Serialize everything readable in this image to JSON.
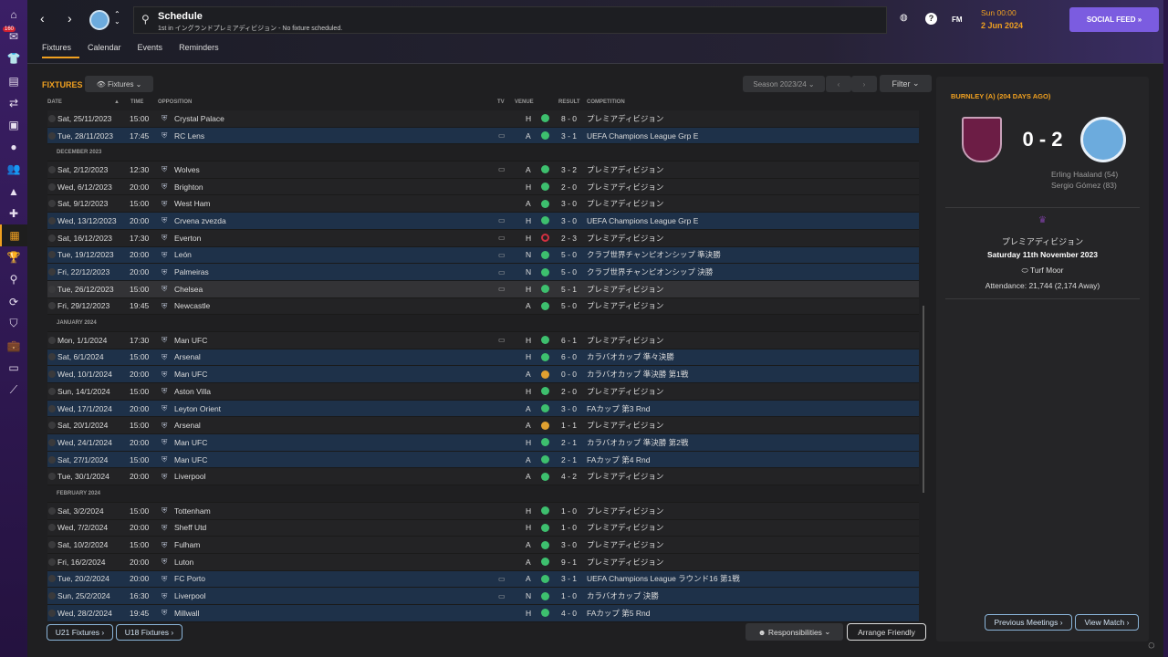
{
  "sidebar": {
    "badge": "160",
    "icons": [
      "home-icon",
      "inbox-icon",
      "squad-icon",
      "tactics-icon",
      "transfers-icon",
      "scouting-icon",
      "ball-icon",
      "staff-icon",
      "training-icon",
      "medical-icon",
      "schedule-icon",
      "trophy-icon",
      "search-icon",
      "refresh-icon",
      "club-icon",
      "finances-icon",
      "dev-icon",
      "misc-icon"
    ]
  },
  "header": {
    "title": "Schedule",
    "subtitle": "1st in イングランドプレミアディビジョン - No fixture scheduled.",
    "time": "Sun 00:00",
    "date": "2 Jun 2024",
    "fm": "FM",
    "social_feed": "SOCIAL FEED"
  },
  "tabs": [
    {
      "label": "Fixtures"
    },
    {
      "label": "Calendar"
    },
    {
      "label": "Events"
    },
    {
      "label": "Reminders"
    }
  ],
  "fixtures": {
    "title": "FIXTURES",
    "view": "Fixtures",
    "season": "Season 2023/24",
    "filter": "Filter",
    "columns": {
      "date": "DATE",
      "time": "TIME",
      "opposition": "OPPOSITION",
      "tv": "TV",
      "venue": "VENUE",
      "result": "RESULT",
      "competition": "COMPETITION"
    },
    "rows": [
      {
        "date": "Sat, 25/11/2023",
        "time": "15:00",
        "team": "Crystal Palace",
        "tv": "",
        "venue": "H",
        "res": "W",
        "score": "8 - 0",
        "comp": "プレミアディビジョン",
        "style": ""
      },
      {
        "date": "Tue, 28/11/2023",
        "time": "17:45",
        "team": "RC Lens",
        "tv": "tv",
        "venue": "A",
        "res": "W",
        "score": "3 - 1",
        "comp": "UEFA Champions League Grp E",
        "style": "hl"
      },
      {
        "month": "DECEMBER 2023"
      },
      {
        "date": "Sat, 2/12/2023",
        "time": "12:30",
        "team": "Wolves",
        "tv": "tv",
        "venue": "A",
        "res": "W",
        "score": "3 - 2",
        "comp": "プレミアディビジョン",
        "style": ""
      },
      {
        "date": "Wed, 6/12/2023",
        "time": "20:00",
        "team": "Brighton",
        "tv": "",
        "venue": "H",
        "res": "W",
        "score": "2 - 0",
        "comp": "プレミアディビジョン",
        "style": ""
      },
      {
        "date": "Sat, 9/12/2023",
        "time": "15:00",
        "team": "West Ham",
        "tv": "",
        "venue": "A",
        "res": "W",
        "score": "3 - 0",
        "comp": "プレミアディビジョン",
        "style": ""
      },
      {
        "date": "Wed, 13/12/2023",
        "time": "20:00",
        "team": "Crvena zvezda",
        "tv": "tv",
        "venue": "H",
        "res": "W",
        "score": "3 - 0",
        "comp": "UEFA Champions League Grp E",
        "style": "hl"
      },
      {
        "date": "Sat, 16/12/2023",
        "time": "17:30",
        "team": "Everton",
        "tv": "tv",
        "venue": "H",
        "res": "L",
        "score": "2 - 3",
        "comp": "プレミアディビジョン",
        "style": ""
      },
      {
        "date": "Tue, 19/12/2023",
        "time": "20:00",
        "team": "León",
        "tv": "tv",
        "venue": "N",
        "res": "W",
        "score": "5 - 0",
        "comp": "クラブ世界チャンピオンシップ 準決勝",
        "style": "hl"
      },
      {
        "date": "Fri, 22/12/2023",
        "time": "20:00",
        "team": "Palmeiras",
        "tv": "tv",
        "venue": "N",
        "res": "W",
        "score": "5 - 0",
        "comp": "クラブ世界チャンピオンシップ 決勝",
        "style": "hl"
      },
      {
        "date": "Tue, 26/12/2023",
        "time": "15:00",
        "team": "Chelsea",
        "tv": "tv",
        "venue": "H",
        "res": "W",
        "score": "5 - 1",
        "comp": "プレミアディビジョン",
        "style": "hv"
      },
      {
        "date": "Fri, 29/12/2023",
        "time": "19:45",
        "team": "Newcastle",
        "tv": "",
        "venue": "A",
        "res": "W",
        "score": "5 - 0",
        "comp": "プレミアディビジョン",
        "style": ""
      },
      {
        "month": "JANUARY 2024"
      },
      {
        "date": "Mon, 1/1/2024",
        "time": "17:30",
        "team": "Man UFC",
        "tv": "tv",
        "venue": "H",
        "res": "W",
        "score": "6 - 1",
        "comp": "プレミアディビジョン",
        "style": ""
      },
      {
        "date": "Sat, 6/1/2024",
        "time": "15:00",
        "team": "Arsenal",
        "tv": "",
        "venue": "H",
        "res": "W",
        "score": "6 - 0",
        "comp": "カラバオカップ 準々決勝",
        "style": "hl"
      },
      {
        "date": "Wed, 10/1/2024",
        "time": "20:00",
        "team": "Man UFC",
        "tv": "",
        "venue": "A",
        "res": "D",
        "score": "0 - 0",
        "comp": "カラバオカップ 準決勝 第1戦",
        "style": "hl"
      },
      {
        "date": "Sun, 14/1/2024",
        "time": "15:00",
        "team": "Aston Villa",
        "tv": "",
        "venue": "H",
        "res": "W",
        "score": "2 - 0",
        "comp": "プレミアディビジョン",
        "style": ""
      },
      {
        "date": "Wed, 17/1/2024",
        "time": "20:00",
        "team": "Leyton Orient",
        "tv": "",
        "venue": "A",
        "res": "W",
        "score": "3 - 0",
        "comp": "FAカップ 第3 Rnd",
        "style": "hl"
      },
      {
        "date": "Sat, 20/1/2024",
        "time": "15:00",
        "team": "Arsenal",
        "tv": "",
        "venue": "A",
        "res": "D",
        "score": "1 - 1",
        "comp": "プレミアディビジョン",
        "style": ""
      },
      {
        "date": "Wed, 24/1/2024",
        "time": "20:00",
        "team": "Man UFC",
        "tv": "",
        "venue": "H",
        "res": "W",
        "score": "2 - 1",
        "comp": "カラバオカップ 準決勝 第2戦",
        "style": "hl"
      },
      {
        "date": "Sat, 27/1/2024",
        "time": "15:00",
        "team": "Man UFC",
        "tv": "",
        "venue": "A",
        "res": "W",
        "score": "2 - 1",
        "comp": "FAカップ 第4 Rnd",
        "style": "hl"
      },
      {
        "date": "Tue, 30/1/2024",
        "time": "20:00",
        "team": "Liverpool",
        "tv": "",
        "venue": "A",
        "res": "W",
        "score": "4 - 2",
        "comp": "プレミアディビジョン",
        "style": ""
      },
      {
        "month": "FEBRUARY 2024"
      },
      {
        "date": "Sat, 3/2/2024",
        "time": "15:00",
        "team": "Tottenham",
        "tv": "",
        "venue": "H",
        "res": "W",
        "score": "1 - 0",
        "comp": "プレミアディビジョン",
        "style": ""
      },
      {
        "date": "Wed, 7/2/2024",
        "time": "20:00",
        "team": "Sheff Utd",
        "tv": "",
        "venue": "H",
        "res": "W",
        "score": "1 - 0",
        "comp": "プレミアディビジョン",
        "style": ""
      },
      {
        "date": "Sat, 10/2/2024",
        "time": "15:00",
        "team": "Fulham",
        "tv": "",
        "venue": "A",
        "res": "W",
        "score": "3 - 0",
        "comp": "プレミアディビジョン",
        "style": ""
      },
      {
        "date": "Fri, 16/2/2024",
        "time": "20:00",
        "team": "Luton",
        "tv": "",
        "venue": "A",
        "res": "W",
        "score": "9 - 1",
        "comp": "プレミアディビジョン",
        "style": ""
      },
      {
        "date": "Tue, 20/2/2024",
        "time": "20:00",
        "team": "FC Porto",
        "tv": "tv",
        "venue": "A",
        "res": "W",
        "score": "3 - 1",
        "comp": "UEFA Champions League ラウンド16 第1戦",
        "style": "hl"
      },
      {
        "date": "Sun, 25/2/2024",
        "time": "16:30",
        "team": "Liverpool",
        "tv": "tv",
        "venue": "N",
        "res": "W",
        "score": "1 - 0",
        "comp": "カラバオカップ 決勝",
        "style": "hl"
      },
      {
        "date": "Wed, 28/2/2024",
        "time": "19:45",
        "team": "Millwall",
        "tv": "",
        "venue": "H",
        "res": "W",
        "score": "4 - 0",
        "comp": "FAカップ 第5 Rnd",
        "style": "hl"
      }
    ],
    "u21": "U21 Fixtures",
    "u18": "U18 Fixtures",
    "responsibilities": "Responsibilities",
    "arrange_friendly": "Arrange Friendly"
  },
  "colors": {
    "win": "#3dbf6e",
    "draw": "#e0a030",
    "loss": "#d03040",
    "accent": "#f0a020",
    "highlight": "#1e3149"
  },
  "match": {
    "title": "BURNLEY (A) (204 DAYS AGO)",
    "score": "0 - 2",
    "scorers": [
      "Erling Haaland (54)",
      "Sergio Gómez (83)"
    ],
    "competition": "プレミアディビジョン",
    "date": "Saturday 11th November 2023",
    "venue": "Turf Moor",
    "attendance": "Attendance: 21,744 (2,174 Away)",
    "previous_meetings": "Previous Meetings",
    "view_match": "View Match"
  }
}
